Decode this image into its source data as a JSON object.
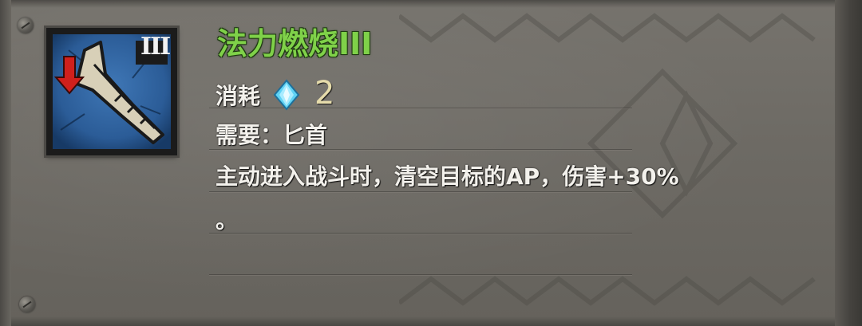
{
  "skill": {
    "title": "法力燃烧III",
    "tier_badge": "III",
    "icon": "dagger-mana-burn-icon",
    "cost_label": "消耗",
    "cost_icon": "mana-crystal-icon",
    "cost_value": "2",
    "requirement": "需要：匕首",
    "description_line1": "主动进入战斗时，清空目标的AP，伤害+30%",
    "description_line2": "。"
  },
  "colors": {
    "title": "#7fd149",
    "text": "#f3f1ec",
    "cost_value": "#e6dcab",
    "panel": "#6d6a64",
    "icon_bg": "#2e5f9e",
    "arrow": "#d0201c"
  }
}
